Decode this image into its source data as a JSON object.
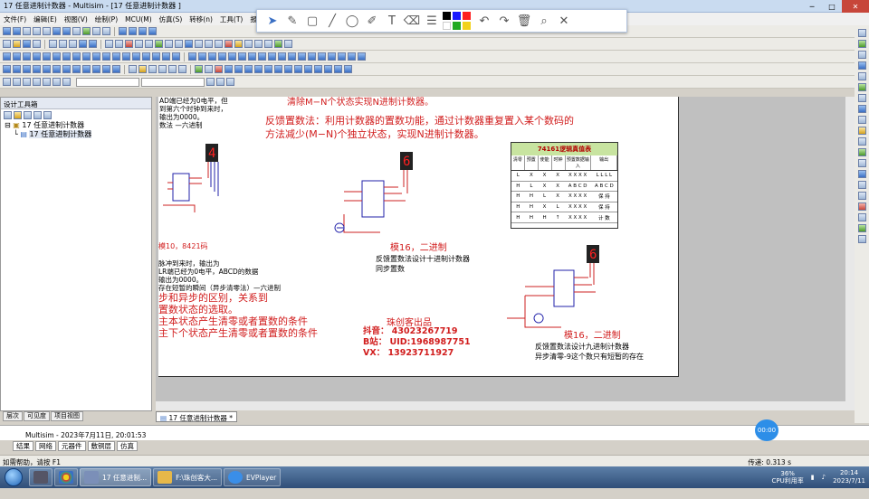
{
  "window": {
    "title": "17 任意进制计数器 - Multisim - [17 任意进制计数器 ]",
    "controls": {
      "min": "─",
      "max": "□",
      "close": "✕"
    }
  },
  "menu": [
    "文件(F)",
    "编辑(E)",
    "视图(V)",
    "绘制(P)",
    "MCU(M)",
    "仿真(S)",
    "转移(n)",
    "工具(T)",
    "报"
  ],
  "colors": {
    "black": "#000000",
    "blue": "#1a1aff",
    "red": "#ff2020",
    "white": "#ffffff",
    "green": "#22aa22",
    "yellow": "#f2d21c"
  },
  "left_panel": {
    "title": "设计工具箱",
    "tree": [
      "17 任意进制计数器",
      "17 任意进制计数器"
    ],
    "tabs": [
      "层次",
      "可见度",
      "项目视图"
    ]
  },
  "sheet": {
    "top_left_lines": [
      "AD端已经为0电平，但",
      "到第六个时钟到来时，",
      "输出为0000。",
      "数法 —六进制"
    ],
    "top_red_line": "清除M−N个状态实现N进制计数器。",
    "feedback_para": [
      "反馈置数法：利用计数器的置数功能，通过计数器重复置入某个数码的",
      "方法减少(M−N)个独立状态，实现N进制计数器。"
    ],
    "mode10_label": "模10，8421码",
    "mode16_label_a": "模16，二进制",
    "mode16_label_b": "模16，二进制",
    "desc_a": [
      "反馈置数法设计十进制计数器",
      "同步置数"
    ],
    "desc_b": [
      "反馈置数法设计九进制计数器",
      "异步清零-9这个数只有短暂的存在"
    ],
    "left_mid_lines": [
      "脉冲到来时，输出为",
      "LR端已经为0电平，ABCD的数据",
      "输出为0000。",
      "存在短暂的瞬间（异步清零法）—六进制"
    ],
    "left_red_lines": [
      "步和异步的区别，关系到",
      "置数状态的选取。",
      "主本状态产生清零或者置数的条件",
      "主下个状态产生清零或者置数的条件"
    ],
    "credit_title": "珠创客出品",
    "credit_lines": [
      "抖音：  43023267719",
      "B站：  UID:1968987751",
      "VX：   13923711927"
    ],
    "table_title": "74161逻辑真值表",
    "table_headers": [
      "清零",
      "预置",
      "使能",
      "时钟",
      "预置数据输入",
      "输出"
    ],
    "table_rows": [
      [
        "L",
        "X",
        "X",
        "X",
        "X X X X",
        "L L L L"
      ],
      [
        "H",
        "L",
        "X",
        "X",
        "A B C D",
        "A B C D"
      ],
      [
        "H",
        "H",
        "L",
        "X",
        "X X X X",
        "保 持"
      ],
      [
        "H",
        "H",
        "X",
        "L",
        "X X X X",
        "保 持"
      ],
      [
        "H",
        "H",
        "H",
        "↑",
        "X X X X",
        "计 数"
      ]
    ],
    "display_a": "4",
    "display_b": "6",
    "display_c": "6"
  },
  "doc_tab": "17 任意进制计数器 *",
  "output_line": "Multisim  -  2023年7月11日, 20:01:53",
  "bottom_tabs": [
    "结果",
    "网络",
    "元器件",
    "敷铜层",
    "仿真"
  ],
  "status": {
    "left": "如需帮助，请按 F1",
    "right": "传递: 0.313 s"
  },
  "timer": "00:00",
  "taskbar": {
    "items": [
      "17 任意进制...",
      "F:\\珠创客大...",
      "EVPlayer"
    ],
    "cpu": [
      "36%",
      "CPU利用率"
    ],
    "time": "20:14",
    "date": "2023/7/11"
  }
}
